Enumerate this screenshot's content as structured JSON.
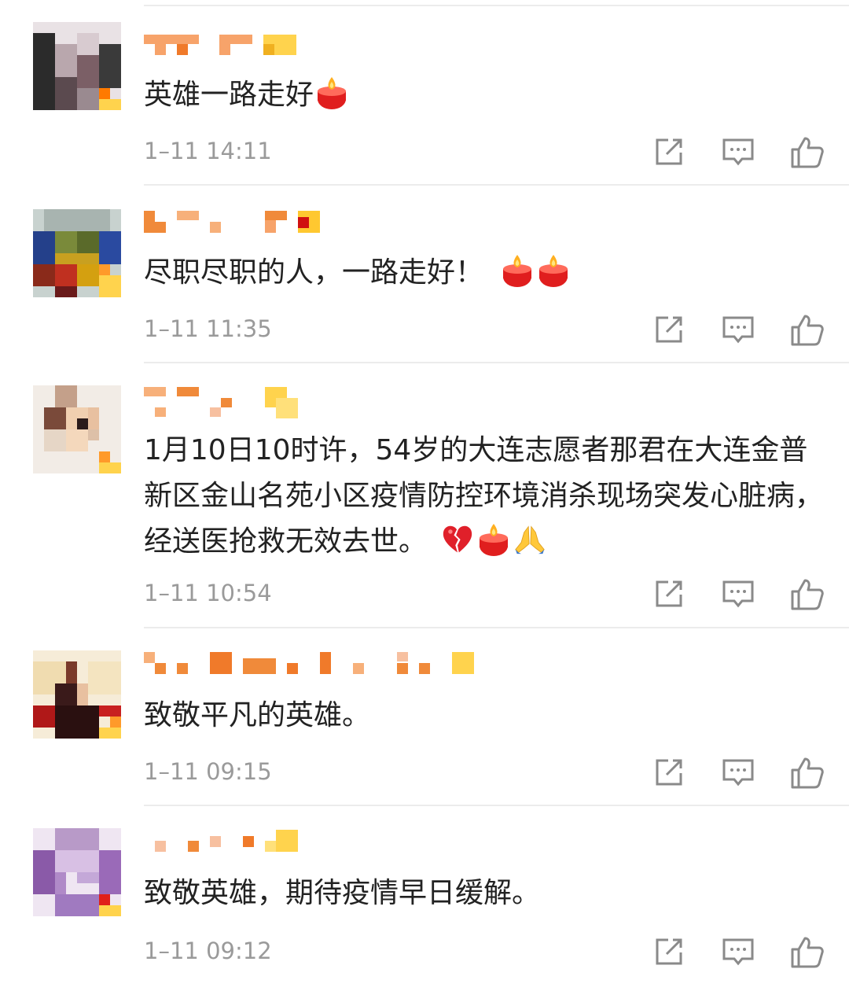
{
  "comments": [
    {
      "time": "1–11 14:11",
      "text": "英雄一路走好",
      "emojis": [
        "candle"
      ]
    },
    {
      "time": "1–11 11:35",
      "text": "尽职尽职的人，一路走好！",
      "emojis": [
        "candle",
        "candle"
      ]
    },
    {
      "time": "1–11 10:54",
      "text": "1月10日10时许，54岁的大连志愿者那君在大连金普新区金山名苑小区疫情防控环境消杀现场突发心脏病，经送医抢救无效去世。",
      "emojis": [
        "broken-heart",
        "candle",
        "folded-hands"
      ]
    },
    {
      "time": "1–11 09:15",
      "text": "致敬平凡的英雄。",
      "emojis": []
    },
    {
      "time": "1–11 09:12",
      "text": "致敬英雄，期待疫情早日缓解。",
      "emojis": []
    }
  ],
  "icons": {
    "share": "share-icon",
    "comment": "comment-icon",
    "like": "like-icon"
  },
  "colors": {
    "text": "#222222",
    "time": "#9a9a9a",
    "icon": "#8a8a8a",
    "divider": "#ececec",
    "name_orange": "#f08a3a"
  }
}
